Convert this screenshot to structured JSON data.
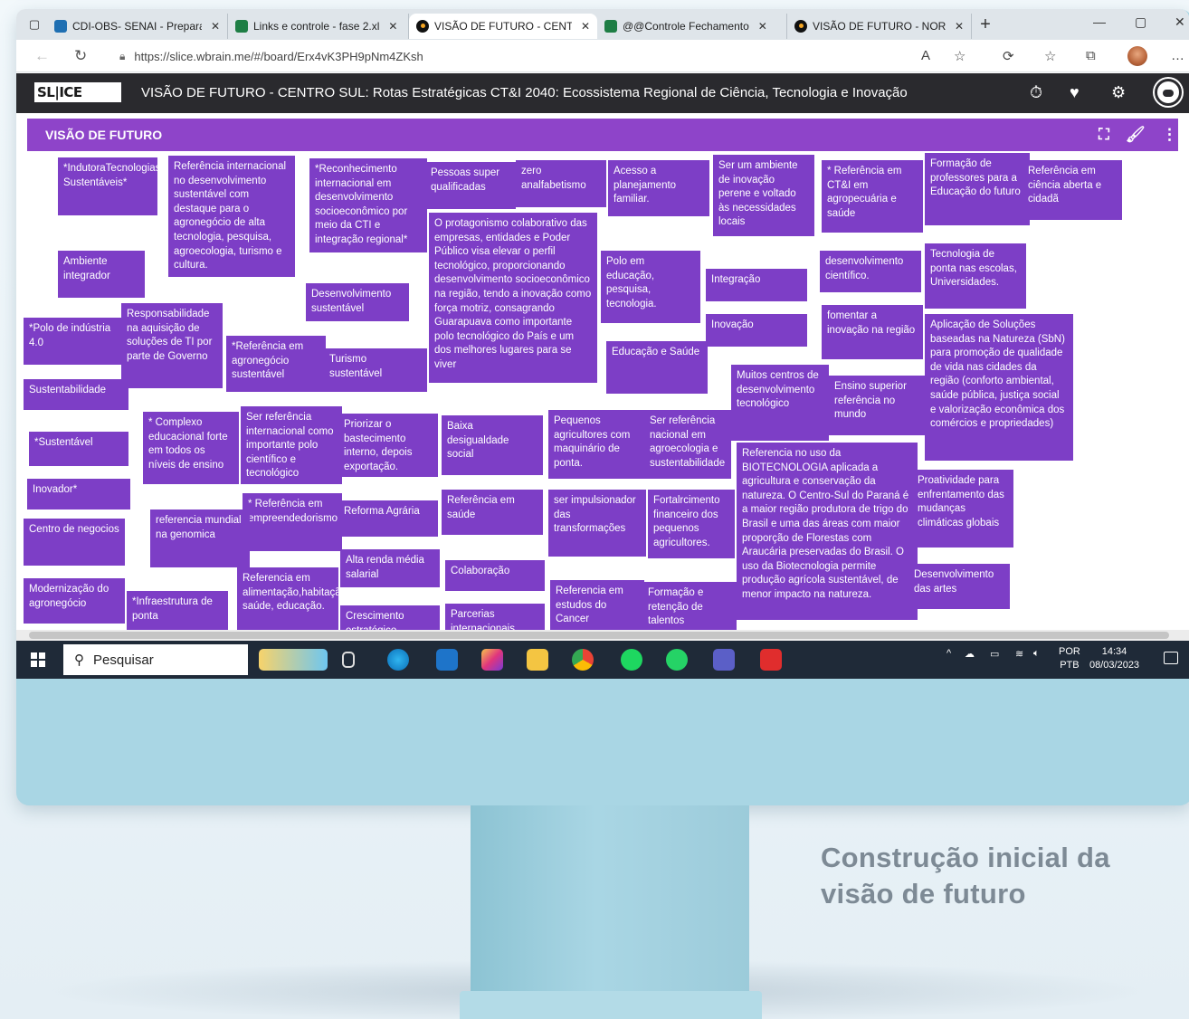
{
  "browser": {
    "tabs": [
      {
        "title": "CDI-OBS- SENAI - Prepara",
        "fav_color": "#1f6fb2"
      },
      {
        "title": "Links e controle - fase 2.xl",
        "fav_color": "#1e7e45"
      },
      {
        "title": "VISÃO DE FUTURO - CENT",
        "fav_color": "#111111",
        "active": true
      },
      {
        "title": "@@Controle Fechamento",
        "fav_color": "#1e7e45"
      },
      {
        "title": "VISÃO DE FUTURO - NOR",
        "fav_color": "#111111"
      }
    ],
    "url": "https://slice.wbrain.me/#/board/Erx4vK3PH9pNm4ZKsh"
  },
  "app": {
    "logo": "SL|ICE",
    "board_title": "VISÃO DE FUTURO - CENTRO SUL: Rotas Estratégicas CT&I 2040: Ecossistema Regional de Ciência, Tecnologia e Inovação"
  },
  "board": {
    "column_title": "VISÃO DE FUTURO",
    "notes": [
      "*IndutoraTecnologias Sustentáveis*",
      "Referência internacional no desenvolvimento sustentável com destaque para o agronegócio de alta tecnologia, pesquisa, agroecologia, turismo e cultura.",
      "*Reconhecimento internacional em desenvolvimento socioeconômico por meio da CTI e integração regional*",
      "Pessoas super qualificadas",
      "zero analfabetismo",
      "Acesso a planejamento familiar.",
      "Ser um ambiente de inovação perene e voltado às necessidades locais",
      "* Referência em CT&I em agropecuária e saúde",
      "Formação de professores para a Educação do futuro",
      "Referência em ciência aberta e cidadã",
      "Ambiente integrador",
      "O protagonismo colaborativo das empresas, entidades e Poder Público visa elevar o perfil tecnológico, proporcionando desenvolvimento socioeconômico na região, tendo a inovação como força motriz, consagrando Guarapuava como importante polo tecnológico do País e um dos melhores lugares para se viver",
      "Polo em educação, pesquisa, tecnologia.",
      "Integração",
      "desenvolvimento científico.",
      "Tecnologia de ponta nas escolas, Universidades.",
      "Desenvolvimento sustentável",
      "*Polo de indústria 4.0",
      "Responsabilidade na aquisição de soluções de TI por parte de Governo",
      "*Referência em agronegócio sustentável",
      "Turismo sustentável",
      "Inovação",
      "fomentar a inovação na região",
      "Aplicação de Soluções baseadas na Natureza (SbN) para promoção de qualidade de vida nas cidades da região (conforto ambiental, saúde pública, justiça social e valorização econômica dos comércios e propriedades)",
      "Educação e Saúde",
      "Sustentabilidade",
      "Muitos centros de desenvolvimento tecnológico",
      "Ensino superior referência no mundo",
      "* Complexo educacional forte em todos os níveis de ensino",
      "Ser referência internacional como importante polo científico e tecnológico",
      "Priorizar o bastecimento interno, depois exportação.",
      "Baixa desigualdade social",
      "Pequenos agricultores com maquinário de ponta.",
      "Ser referência nacional em agroecologia e sustentabilidade",
      "*Sustentável",
      "Referencia no uso da BIOTECNOLOGIA aplicada a agricultura e conservação da natureza. O Centro-Sul do Paraná é a maior região produtora de trigo do Brasil e uma das áreas com maior proporção de Florestas com Araucária preservadas do Brasil. O uso da Biotecnologia permite produção agrícola sustentável, de menor impacto na natureza.",
      "Proatividade para enfrentamento das mudanças climáticas globais",
      "Inovador*",
      "* Referência em empreendedorismo",
      "Reforma Agrária",
      "Referência em saúde",
      "ser impulsionador das transformações",
      "Fortalrcimento financeiro dos pequenos agricultores.",
      "Centro de negocios",
      "referencia mundial na genomica",
      "Alta renda média salarial",
      "Colaboração",
      "Desenvolvimento das artes",
      "Modernização do agronegócio",
      "*Infraestrutura de ponta",
      "Referencia em alimentação,habitação, saúde, educação.",
      "Crescimento estratégico",
      "Parcerias internacionais",
      "Referencia em estudos do Cancer",
      "Formação e retenção de talentos"
    ]
  },
  "taskbar": {
    "search_label": "Pesquisar",
    "lang_1": "POR",
    "lang_2": "PTB",
    "time": "14:34",
    "date": "08/03/2023"
  },
  "caption": "Construção inicial da visão de futuro",
  "colors": {
    "note": "#7d3ec6",
    "board_bar": "#8e44c9",
    "header": "#2a2a2e",
    "monitor": "#a9d6e4"
  }
}
